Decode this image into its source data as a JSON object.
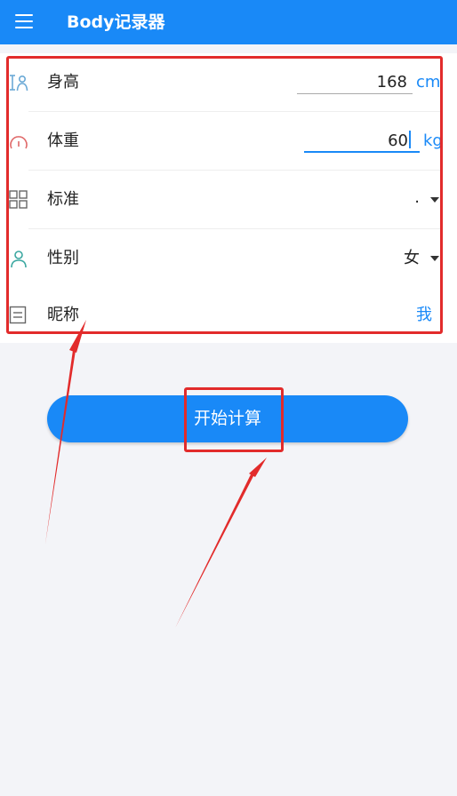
{
  "app_bar": {
    "title": "Body记录器",
    "menu_icon": "hamburger-menu-icon",
    "color": "#1989f7"
  },
  "form": {
    "height": {
      "label": "身高",
      "value": "168",
      "unit": "cm",
      "icon": "ruler-person-icon"
    },
    "weight": {
      "label": "体重",
      "value": "60",
      "unit": "kg",
      "icon": "scale-gauge-icon"
    },
    "standard": {
      "label": "标准",
      "value": ".",
      "icon": "grid-icon"
    },
    "gender": {
      "label": "性别",
      "value": "女",
      "icon": "person-icon"
    },
    "nickname": {
      "label": "昵称",
      "value": "我",
      "icon": "text-box-icon"
    }
  },
  "actions": {
    "calculate_label": "开始计算"
  },
  "annotations": {
    "highlight_color": "#e22b2b"
  }
}
